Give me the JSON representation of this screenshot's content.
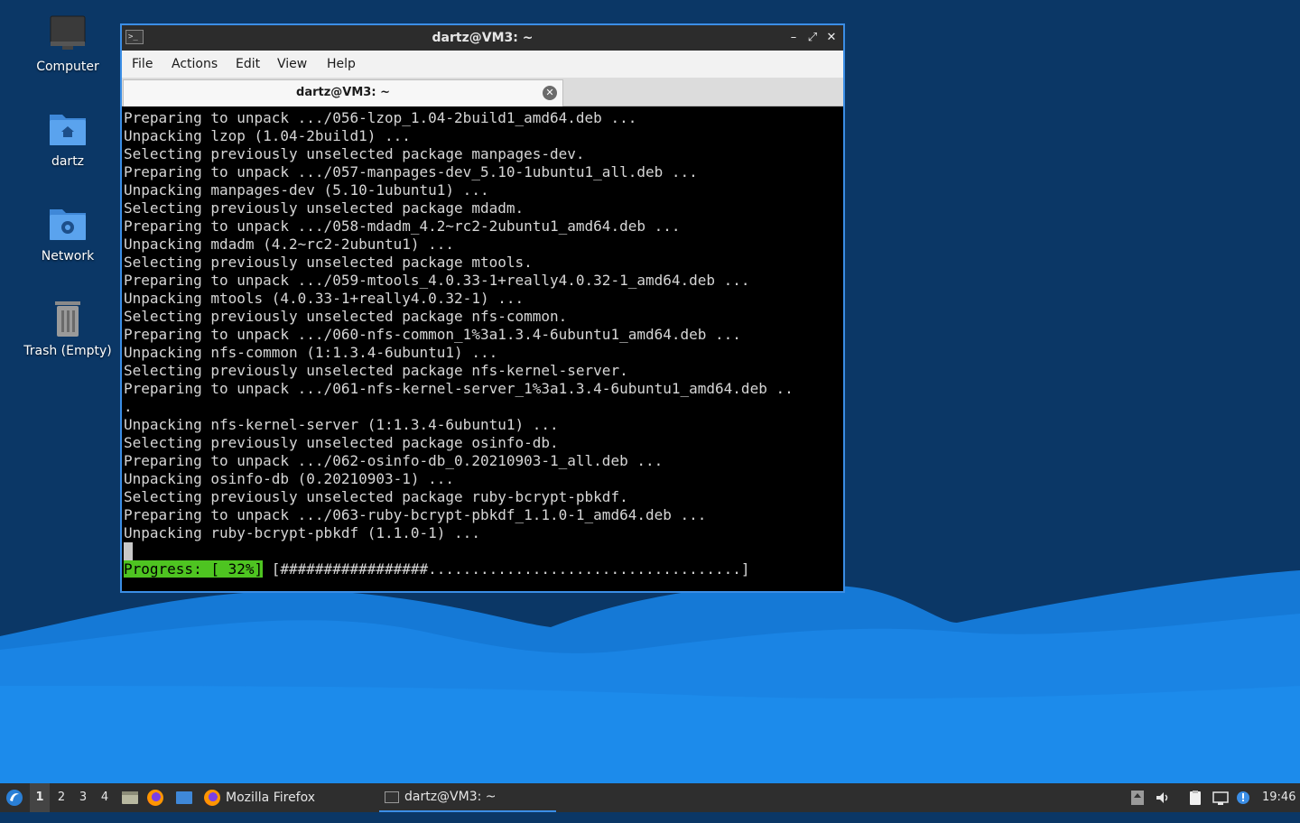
{
  "desktop": {
    "icons": [
      {
        "label": "Computer"
      },
      {
        "label": "dartz"
      },
      {
        "label": "Network"
      },
      {
        "label": "Trash (Empty)"
      }
    ]
  },
  "window": {
    "title": "dartz@VM3: ~",
    "menu": [
      "File",
      "Actions",
      "Edit",
      "View",
      "Help"
    ],
    "tab_title": "dartz@VM3: ~",
    "terminal_lines": [
      "Preparing to unpack .../056-lzop_1.04-2build1_amd64.deb ...",
      "Unpacking lzop (1.04-2build1) ...",
      "Selecting previously unselected package manpages-dev.",
      "Preparing to unpack .../057-manpages-dev_5.10-1ubuntu1_all.deb ...",
      "Unpacking manpages-dev (5.10-1ubuntu1) ...",
      "Selecting previously unselected package mdadm.",
      "Preparing to unpack .../058-mdadm_4.2~rc2-2ubuntu1_amd64.deb ...",
      "Unpacking mdadm (4.2~rc2-2ubuntu1) ...",
      "Selecting previously unselected package mtools.",
      "Preparing to unpack .../059-mtools_4.0.33-1+really4.0.32-1_amd64.deb ...",
      "Unpacking mtools (4.0.33-1+really4.0.32-1) ...",
      "Selecting previously unselected package nfs-common.",
      "Preparing to unpack .../060-nfs-common_1%3a1.3.4-6ubuntu1_amd64.deb ...",
      "Unpacking nfs-common (1:1.3.4-6ubuntu1) ...",
      "Selecting previously unselected package nfs-kernel-server.",
      "Preparing to unpack .../061-nfs-kernel-server_1%3a1.3.4-6ubuntu1_amd64.deb ..",
      ".",
      "Unpacking nfs-kernel-server (1:1.3.4-6ubuntu1) ...",
      "Selecting previously unselected package osinfo-db.",
      "Preparing to unpack .../062-osinfo-db_0.20210903-1_all.deb ...",
      "Unpacking osinfo-db (0.20210903-1) ...",
      "Selecting previously unselected package ruby-bcrypt-pbkdf.",
      "Preparing to unpack .../063-ruby-bcrypt-pbkdf_1.1.0-1_amd64.deb ...",
      "Unpacking ruby-bcrypt-pbkdf (1.1.0-1) ..."
    ],
    "progress_label": "Progress: [ 32%]",
    "progress_bar": " [#################....................................]"
  },
  "taskbar": {
    "workspaces": [
      "1",
      "2",
      "3",
      "4"
    ],
    "tasks": [
      {
        "label": "Mozilla Firefox"
      },
      {
        "label": "dartz@VM3: ~"
      }
    ],
    "clock": "19:46"
  },
  "colors": {
    "accent": "#3b8ee6",
    "progress": "#4ec421",
    "desktop_bg": "#0b3766"
  }
}
